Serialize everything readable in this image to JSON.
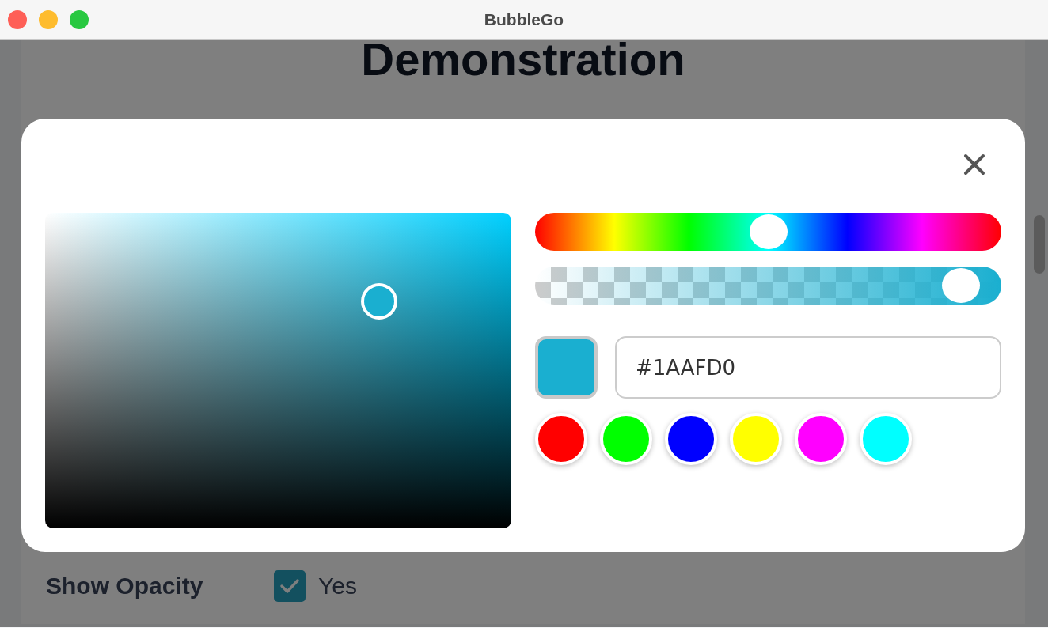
{
  "window": {
    "title": "BubbleGo"
  },
  "page": {
    "heading": "Demonstration",
    "show_opacity": {
      "label": "Show Opacity",
      "option": "Yes",
      "checked": true
    }
  },
  "picker": {
    "hue": {
      "level": 0.5
    },
    "alpha": {
      "level": 0.95
    },
    "hex": "#1AAFD0",
    "presets": [
      {
        "color": "#ff0000"
      },
      {
        "color": "#00ff00"
      },
      {
        "color": "#0000ff"
      },
      {
        "color": "#ffff00"
      },
      {
        "color": "#ff00ff"
      },
      {
        "color": "#00ffff"
      }
    ]
  }
}
